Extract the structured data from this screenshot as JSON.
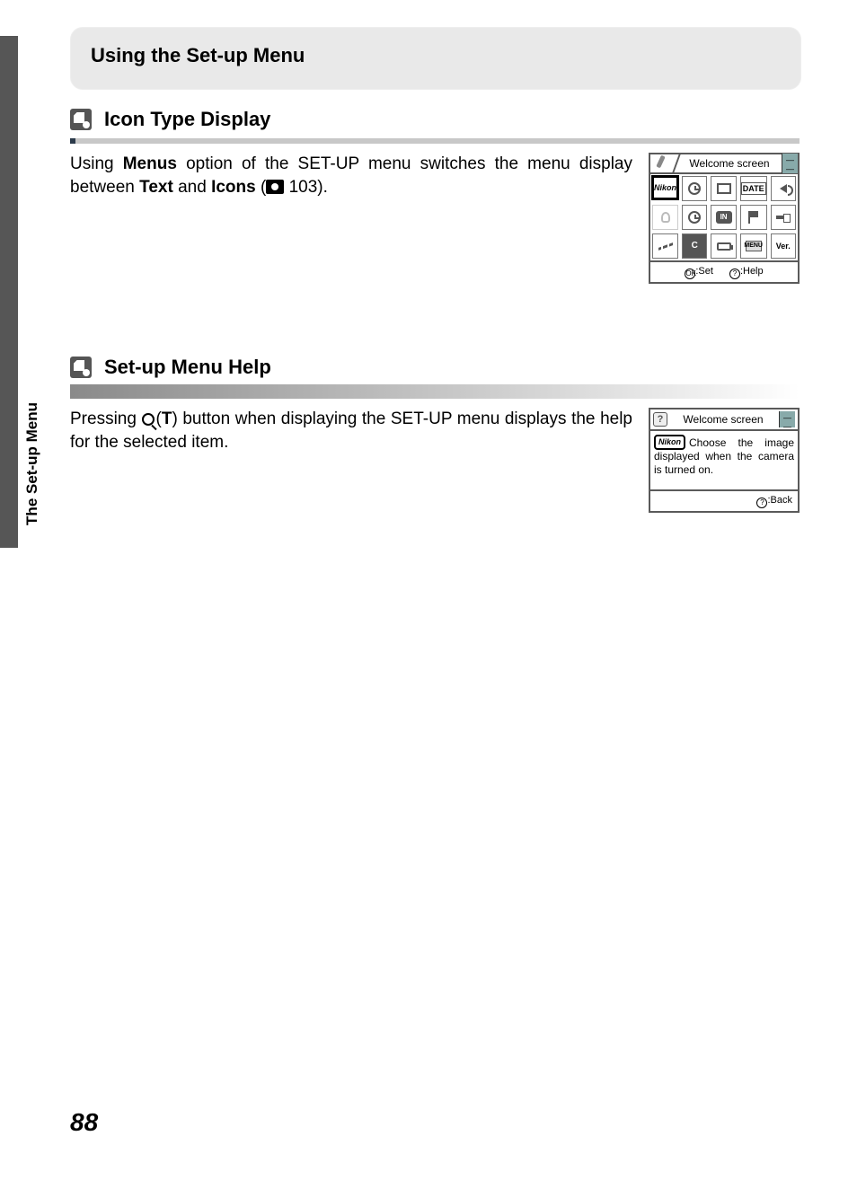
{
  "page": {
    "number": "88",
    "side_tab_label": "The Set-up Menu",
    "header": "Using the Set-up Menu"
  },
  "section1": {
    "title": "Icon Type Display",
    "para_prefix": "Using ",
    "para_bold1": "Menus",
    "para_mid1": " option of the SET-UP menu switches the menu display between ",
    "para_bold2": "Text",
    "para_mid2": " and ",
    "para_bold3": "Icons",
    "para_suffix": " (",
    "para_ref": " 103).",
    "fig": {
      "title": "Welcome screen",
      "footer_set": ":Set",
      "footer_help": ":Help",
      "ok_label": "OK",
      "q_label": "?",
      "cells": {
        "nikon": "Nikon",
        "date": "DATE",
        "in": "IN",
        "ver": "Ver.",
        "menu": "MENU",
        "c": "C"
      }
    }
  },
  "section2": {
    "title": "Set-up Menu Help",
    "para_prefix": "Pressing ",
    "para_button": "T",
    "para_mid": ") button when displaying the SET-UP menu displays the help for the selected item.",
    "fig": {
      "title": "Welcome screen",
      "nikon": "Nikon",
      "body": "Choose the image displayed when the camera is turned on.",
      "footer_back": ":Back",
      "q_label": "?"
    }
  }
}
